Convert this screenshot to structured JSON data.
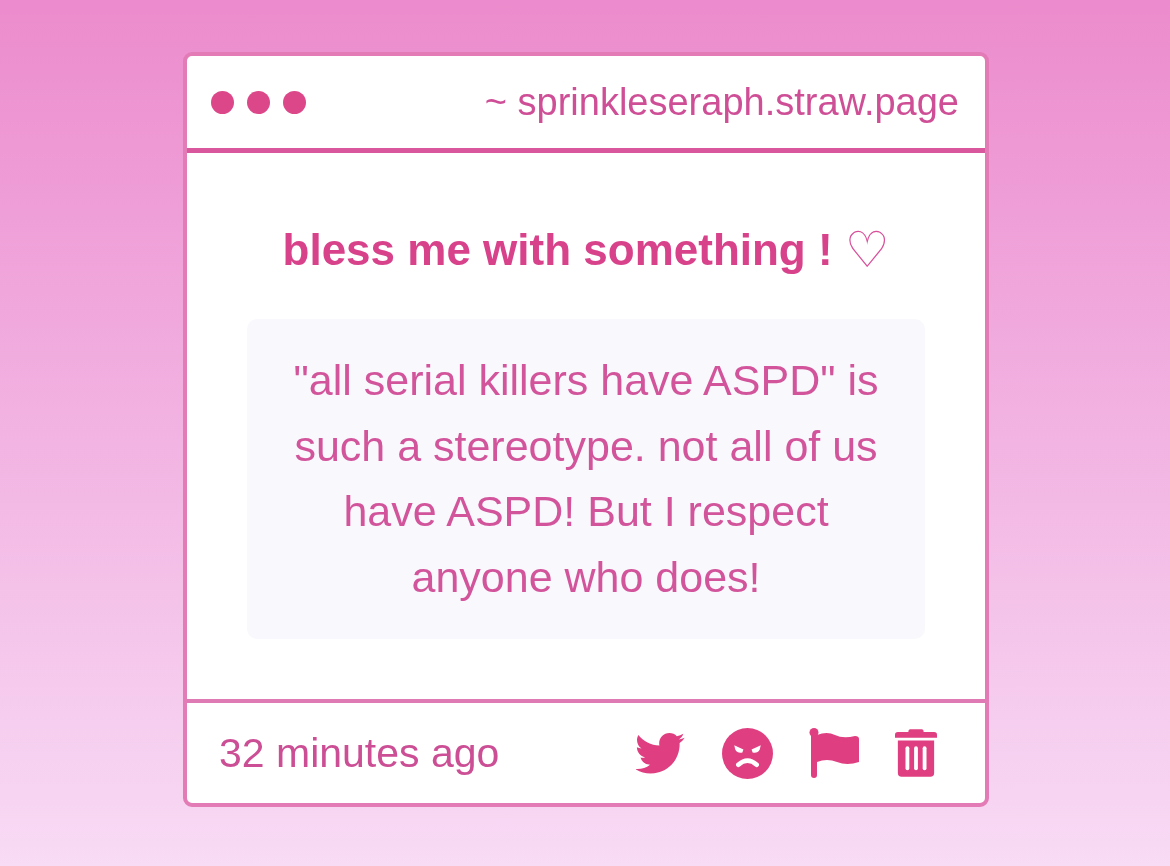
{
  "window": {
    "address": "~ sprinkleseraph.straw.page"
  },
  "post": {
    "title": "bless me with something !",
    "title_symbol": "♡",
    "message": "\"all serial killers have ASPD\" is such a stereotype. not all of us have ASPD! But I respect anyone who does!"
  },
  "footer": {
    "time": "32 minutes ago"
  }
}
